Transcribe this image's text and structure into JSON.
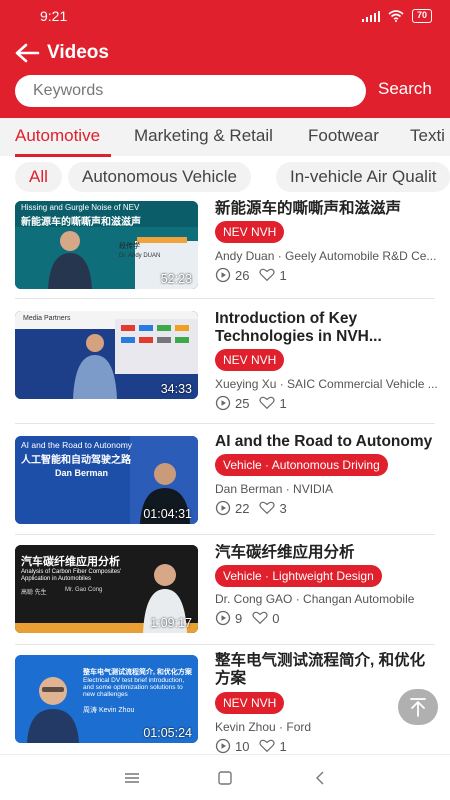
{
  "status": {
    "time": "9:21",
    "battery": "70"
  },
  "header": {
    "title": "Videos",
    "search_placeholder": "Keywords",
    "search_label": "Search"
  },
  "categories": [
    "Automotive",
    "Marketing & Retail",
    "Footwear",
    "Texti"
  ],
  "subcategories": [
    "All",
    "Autonomous Vehicle",
    "In-vehicle Air Qualit"
  ],
  "videos": [
    {
      "title": "新能源车的嘶嘶声和滋滋声",
      "tag": "NEV NVH",
      "meta": "Andy Duan · Geely Automobile R&D Ce...",
      "views": "26",
      "likes": "1",
      "duration": "52:23",
      "thumb": {
        "line1": "Hissing and Gurgle Noise of NEV",
        "line2": "新能源车的嘶嘶声和滋滋声",
        "name_cn": "段传学",
        "name_en": "Dr. Andy DUAN",
        "bg": "#0e6f7a"
      }
    },
    {
      "title": "Introduction of Key Technologies in NVH...",
      "tag": "NEV NVH",
      "meta": "Xueying Xu · SAIC Commercial Vehicle ...",
      "views": "25",
      "likes": "1",
      "duration": "34:33",
      "thumb": {
        "line1": "Media Partners",
        "line2": "",
        "name_cn": "",
        "name_en": "",
        "bg": "#1d3f8a"
      }
    },
    {
      "title": "AI and the Road to Autonomy",
      "tag": "Vehicle · Autonomous Driving",
      "meta": "Dan Berman · NVIDIA",
      "views": "22",
      "likes": "3",
      "duration": "01:04:31",
      "thumb": {
        "line1": "AI and the Road to Autonomy",
        "line2": "人工智能和自动驾驶之路",
        "name_cn": "",
        "name_en": "Dan Berman",
        "bg": "#1e4fa8"
      }
    },
    {
      "title": "汽车碳纤维应用分析",
      "tag": "Vehicle · Lightweight Design",
      "meta": "Dr. Cong GAO · Changan Automobile",
      "views": "9",
      "likes": "0",
      "duration": "1:09:17",
      "thumb": {
        "line1": "汽车碳纤维应用分析",
        "line2": "Analysis of Carbon Fiber Composites' Application in Automobiles",
        "name_cn": "高聪 先生",
        "name_en": "Mr. Gao Cong",
        "bg": "#1a1a1a"
      }
    },
    {
      "title": "整车电气测试流程简介, 和优化方案",
      "tag": "NEV NVH",
      "meta": "Kevin Zhou · Ford",
      "views": "10",
      "likes": "1",
      "duration": "01:05:24",
      "thumb": {
        "line1": "整车电气测试流程简介, 和优化方案",
        "line2": "Electrical DV test brief introduction, and some optimization solutions to new challenges",
        "name_cn": "周涛 Kevin Zhou",
        "name_en": "",
        "bg": "#1c6fd0"
      }
    }
  ],
  "colors": {
    "accent": "#e0202d"
  },
  "icons": {
    "back": "arrow-left-icon",
    "views": "play-circle-icon",
    "likes": "heart-icon",
    "top": "arrow-up-icon"
  }
}
